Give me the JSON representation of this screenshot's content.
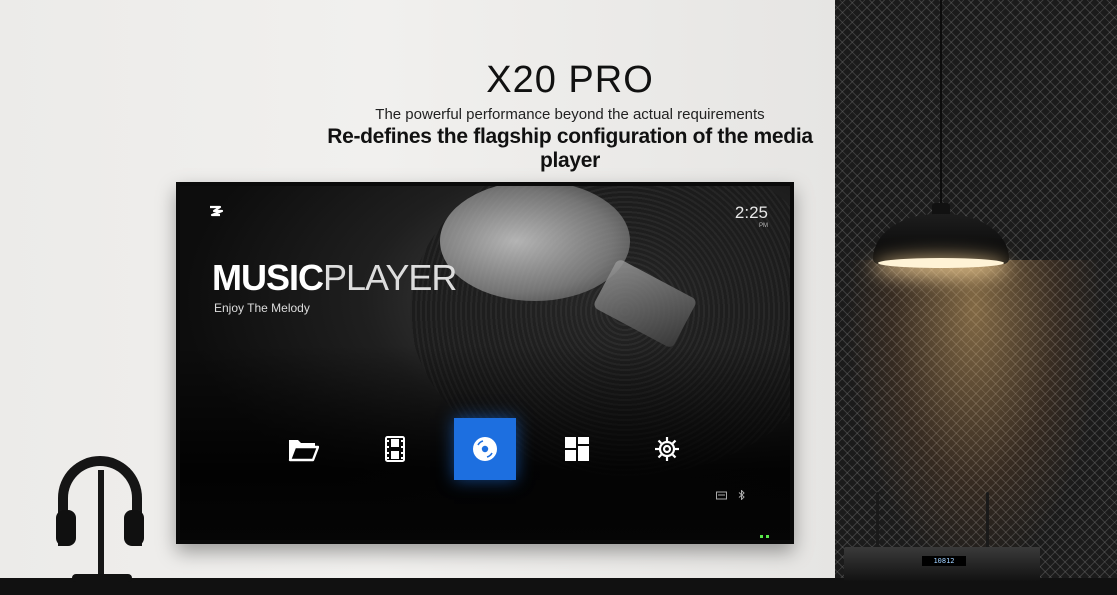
{
  "header": {
    "title": "X20 PRO",
    "subtitle": "The powerful performance beyond the actual requirements",
    "tagline": "Re-defines the flagship configuration of the media player"
  },
  "screen": {
    "clock": {
      "time": "2:25",
      "ampm": "PM"
    },
    "app_title_bold": "MUSIC",
    "app_title_thin": "PLAYER",
    "app_subtitle": "Enjoy The Melody",
    "dock": [
      {
        "icon": "folder-icon",
        "selected": false
      },
      {
        "icon": "film-icon",
        "selected": false
      },
      {
        "icon": "disc-icon",
        "selected": true
      },
      {
        "icon": "apps-grid-icon",
        "selected": false
      },
      {
        "icon": "settings-gear-icon",
        "selected": false
      }
    ],
    "status_icons": [
      "storage-icon",
      "bluetooth-icon"
    ],
    "accent_color": "#1d6fe0"
  },
  "device": {
    "display_text": "10812"
  }
}
